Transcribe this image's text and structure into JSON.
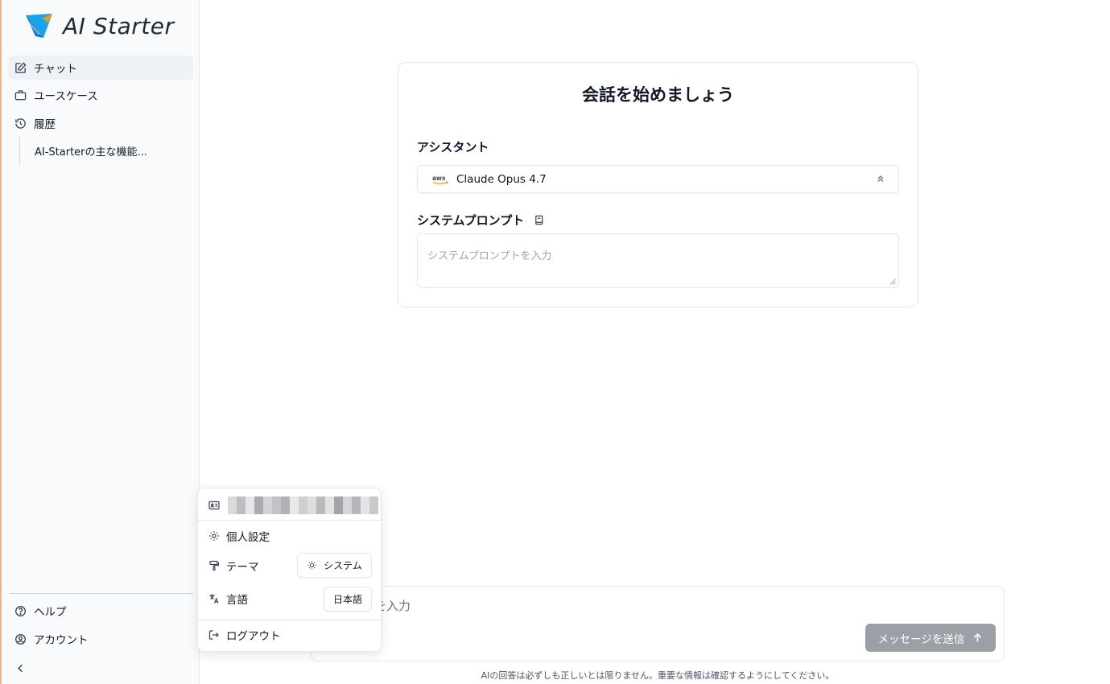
{
  "app": {
    "logo_text": "AI Starter"
  },
  "sidebar": {
    "items": [
      {
        "label": "チャット",
        "icon": "edit-icon",
        "active": true
      },
      {
        "label": "ユースケース",
        "icon": "briefcase-icon"
      },
      {
        "label": "履歴",
        "icon": "history-icon"
      }
    ],
    "history_items": [
      {
        "label": "AI-Starterの主な機能..."
      }
    ],
    "bottom_items": [
      {
        "label": "ヘルプ",
        "icon": "help-icon"
      },
      {
        "label": "アカウント",
        "icon": "account-icon"
      }
    ],
    "collapse_icon": "chevron-left-icon"
  },
  "main": {
    "title": "会話を始めましょう",
    "assistant_label": "アシスタント",
    "model": {
      "name": "Claude Opus 4.7",
      "provider_icon": "aws-icon"
    },
    "system_prompt_label": "システムプロンプト",
    "system_prompt_placeholder": "システムプロンプトを入力",
    "message_placeholder": "を入力",
    "send_label": "メッセージを送信",
    "disclaimer": "AIの回答は必ずしも正しいとは限りません。重要な情報は確認するようにしてください。"
  },
  "account_menu": {
    "personal_settings": "個人設定",
    "theme_label": "テーマ",
    "theme_value": "システム",
    "language_label": "言語",
    "language_value": "日本語",
    "logout": "ログアウト"
  },
  "colors": {
    "accent_edge": "#f0b48c",
    "send_button": "#9ca0a6",
    "sidebar_bg": "#f8fafc"
  }
}
